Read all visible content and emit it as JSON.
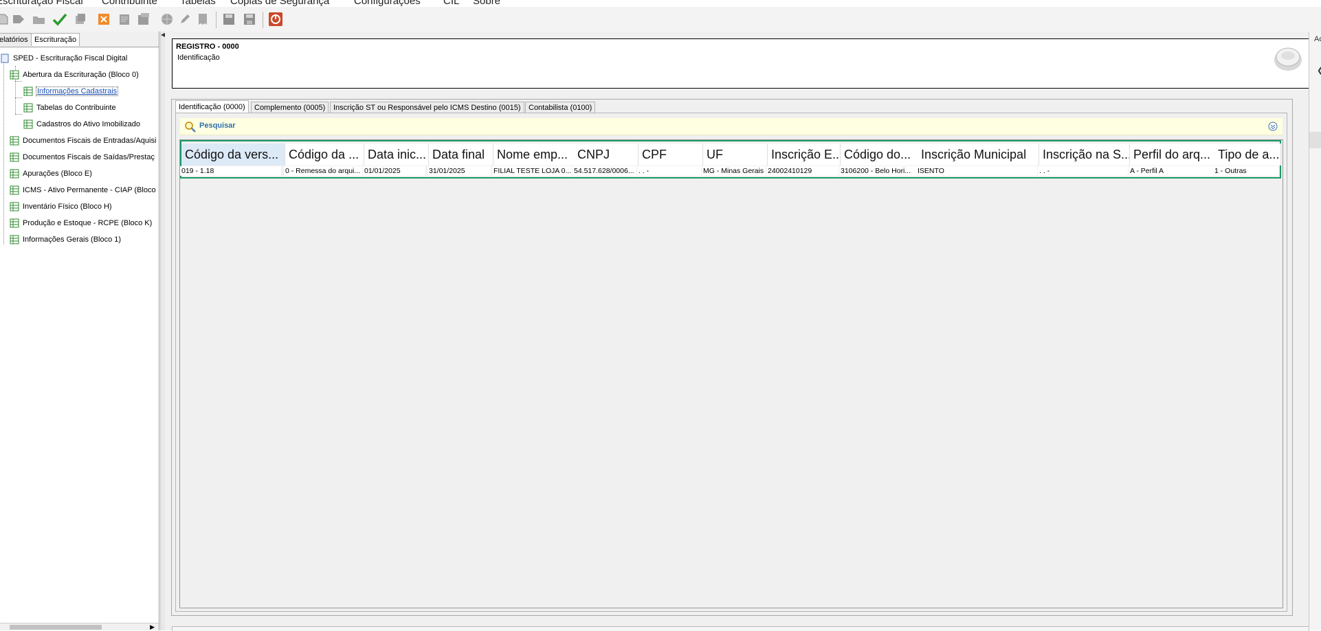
{
  "menu": {
    "items": [
      "Escrituração Fiscal",
      "Contribuinte",
      "Tabelas",
      "Cópias de Segurança",
      "Configurações",
      "CIL",
      "Sobre"
    ]
  },
  "toolbar": {
    "icons": [
      "new-icon",
      "forward-icon",
      "open-folder-icon",
      "validate-check-icon",
      "copy-icon",
      "close-x-icon",
      "sign-icon",
      "transmit-icon",
      "globe-icon",
      "edit-icon",
      "receipt-icon",
      "save-icon",
      "save-as-icon",
      "exit-icon"
    ]
  },
  "left_panel": {
    "tabs": [
      "elatórios",
      "Escrituração"
    ],
    "active_tab": "Escrituração",
    "tree": {
      "root": "SPED - Escrituração Fiscal Digital",
      "n1": "Abertura da Escrituração (Bloco 0)",
      "n1_1": "Informações Cadastrais",
      "n1_2": "Tabelas do Contribuinte",
      "n1_3": "Cadastros do Ativo Imobilizado",
      "n2": "Documentos Fiscais de Entradas/Aquisi",
      "n3": "Documentos Fiscais de Saídas/Prestaç",
      "n4": "Apurações (Bloco E)",
      "n5": "ICMS - Ativo Permanente - CIAP (Bloco",
      "n6": "Inventário Físico (Bloco H)",
      "n7": "Produção e Estoque - RCPE (Bloco K)",
      "n8": "Informações Gerais (Bloco 1)"
    }
  },
  "header": {
    "title": "REGISTRO - 0000",
    "subtitle": "Identificação"
  },
  "tabs": {
    "t0": "Identificação (0000)",
    "t1": "Complemento (0005)",
    "t2": "Inscrição ST ou Responsável pelo ICMS Destino (0015)",
    "t3": "Contabilista (0100)"
  },
  "search": {
    "label": "Pesquisar"
  },
  "table": {
    "headers": {
      "c0": "Código da vers...",
      "c1": "Código da ...",
      "c2": "Data inic...",
      "c3": "Data final",
      "c4": "Nome emp...",
      "c5": "CNPJ",
      "c6": "CPF",
      "c7": "UF",
      "c8": "Inscrição E...",
      "c9": "Código do...",
      "c10": "Inscrição Municipal",
      "c11": "Inscrição na S...",
      "c12": "Perfil do arq...",
      "c13": "Tipo de a..."
    },
    "row0": {
      "c0": "019 - 1.18",
      "c1": "0 - Remessa do arqui...",
      "c2": "01/01/2025",
      "c3": "31/01/2025",
      "c4": "FILIAL TESTE LOJA 0...",
      "c5": "54.517.628/0006...",
      "c6": ". . -",
      "c7": "MG - Minas Gerais",
      "c8": "24002410129",
      "c9": "3106200 - Belo Hori...",
      "c10": "ISENTO",
      "c11": ". . -",
      "c12": "A - Perfil A",
      "c13": "1 - Outras"
    }
  },
  "right_strip": {
    "label": "Ac"
  },
  "colors": {
    "highlight_border": "#1a9a66",
    "search_bg": "#ffffe1",
    "search_text": "#2e6fb0",
    "selected_header_bg": "#dce9f7"
  }
}
